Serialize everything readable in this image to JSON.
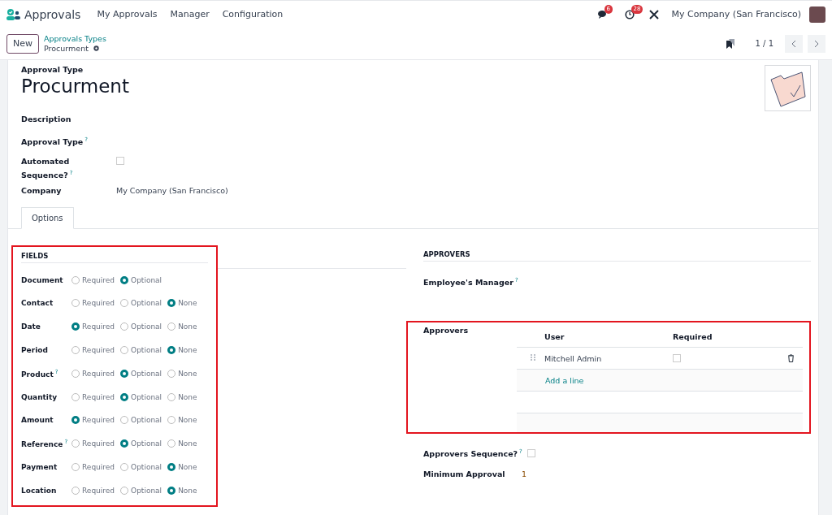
{
  "navbar": {
    "app_name": "Approvals",
    "menu": [
      "My Approvals",
      "Manager",
      "Configuration"
    ],
    "messages_count": "6",
    "activities_count": "28",
    "company": "My Company (San Francisco)"
  },
  "control_panel": {
    "new_button": "New",
    "breadcrumb": "Approvals Types",
    "current": "Procurment",
    "pager": "1 / 1"
  },
  "form": {
    "title_label": "Approval Type",
    "title": "Procurment",
    "fields_top": [
      {
        "kind": "empty",
        "label": "Description"
      },
      {
        "kind": "empty",
        "label": "Approval Type",
        "help": "?"
      },
      {
        "kind": "checkbox",
        "label": "Automated Sequence?",
        "help": "?",
        "checked": false
      },
      {
        "kind": "text",
        "label": "Company",
        "value": "My Company (San Francisco)"
      }
    ],
    "tabs": [
      {
        "label": "Options",
        "selected": true
      }
    ],
    "fields_section": {
      "title": "FIELDS",
      "rows": [
        {
          "label": "Document",
          "options": [
            {
              "label": "Required",
              "selected": false
            },
            {
              "label": "Optional",
              "selected": true
            }
          ]
        },
        {
          "label": "Contact",
          "options": [
            {
              "label": "Required",
              "selected": false
            },
            {
              "label": "Optional",
              "selected": false
            },
            {
              "label": "None",
              "selected": true
            }
          ]
        },
        {
          "label": "Date",
          "options": [
            {
              "label": "Required",
              "selected": true
            },
            {
              "label": "Optional",
              "selected": false
            },
            {
              "label": "None",
              "selected": false
            }
          ]
        },
        {
          "label": "Period",
          "options": [
            {
              "label": "Required",
              "selected": false
            },
            {
              "label": "Optional",
              "selected": false
            },
            {
              "label": "None",
              "selected": true
            }
          ]
        },
        {
          "label": "Product",
          "help": "?",
          "options": [
            {
              "label": "Required",
              "selected": false
            },
            {
              "label": "Optional",
              "selected": true
            },
            {
              "label": "None",
              "selected": false
            }
          ]
        },
        {
          "label": "Quantity",
          "options": [
            {
              "label": "Required",
              "selected": false
            },
            {
              "label": "Optional",
              "selected": true
            },
            {
              "label": "None",
              "selected": false
            }
          ]
        },
        {
          "label": "Amount",
          "options": [
            {
              "label": "Required",
              "selected": true
            },
            {
              "label": "Optional",
              "selected": false
            },
            {
              "label": "None",
              "selected": false
            }
          ]
        },
        {
          "label": "Reference",
          "help": "?",
          "options": [
            {
              "label": "Required",
              "selected": false
            },
            {
              "label": "Optional",
              "selected": true
            },
            {
              "label": "None",
              "selected": false
            }
          ]
        },
        {
          "label": "Payment",
          "options": [
            {
              "label": "Required",
              "selected": false
            },
            {
              "label": "Optional",
              "selected": false
            },
            {
              "label": "None",
              "selected": true
            }
          ]
        },
        {
          "label": "Location",
          "options": [
            {
              "label": "Required",
              "selected": false
            },
            {
              "label": "Optional",
              "selected": false
            },
            {
              "label": "None",
              "selected": true
            }
          ]
        }
      ]
    },
    "approvers_section": {
      "title": "APPROVERS",
      "manager_label": "Employee's Manager",
      "manager_help": "?",
      "approvers_label": "Approvers",
      "columns": [
        "User",
        "Required"
      ],
      "rows": [
        {
          "user": "Mitchell Admin",
          "required": false
        }
      ],
      "add_line": "Add a line",
      "sequence_label": "Approvers Sequence?",
      "sequence_help": "?",
      "sequence_checked": false,
      "minimum_label": "Minimum Approval",
      "minimum_value": "1"
    }
  }
}
